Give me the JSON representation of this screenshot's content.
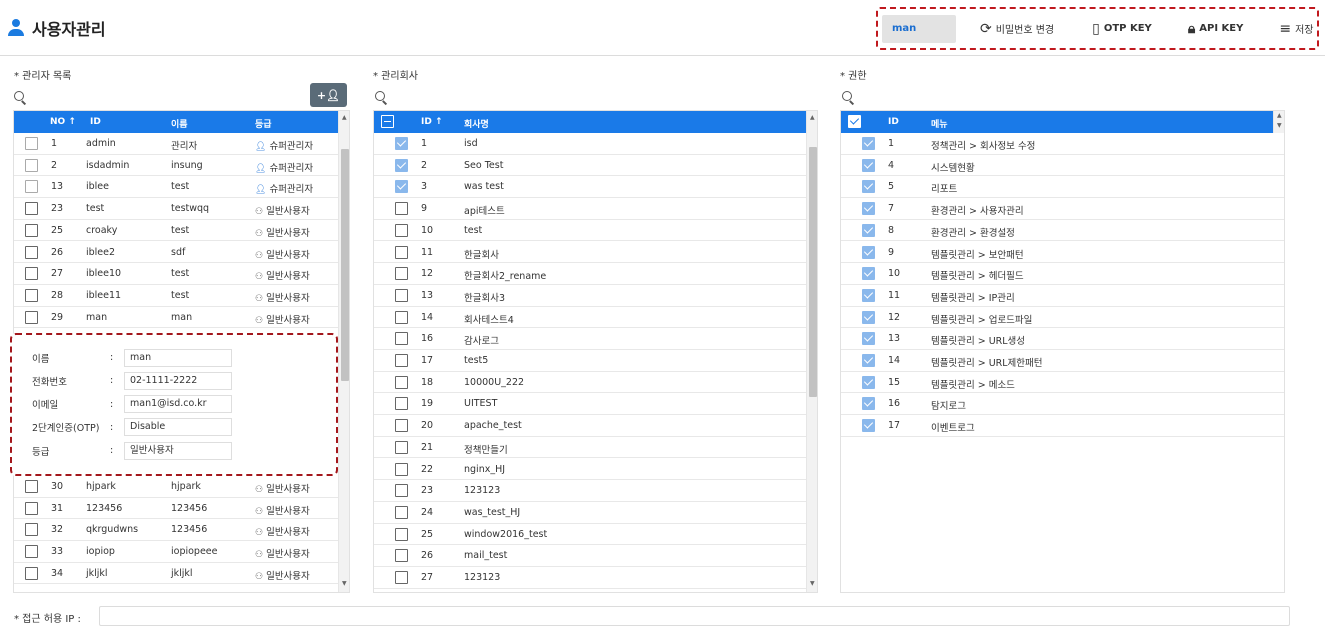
{
  "header": {
    "title": "사용자관리",
    "current_user": "man",
    "buttons": {
      "change_password": "비밀번호 변경",
      "otp_key": "OTP KEY",
      "api_key": "API KEY",
      "save": "저장"
    }
  },
  "admin_list": {
    "title": "* 관리자 목록",
    "columns": {
      "no": "NO",
      "id": "ID",
      "name": "이름",
      "grade": "등급"
    },
    "rows_top": [
      {
        "no": "1",
        "id": "admin",
        "name": "관리자",
        "grade": "슈퍼관리자",
        "type": "super",
        "dim": true
      },
      {
        "no": "2",
        "id": "isdadmin",
        "name": "insung",
        "grade": "슈퍼관리자",
        "type": "super",
        "dim": true
      },
      {
        "no": "13",
        "id": "iblee",
        "name": "test",
        "grade": "슈퍼관리자",
        "type": "super",
        "dim": true
      },
      {
        "no": "23",
        "id": "test",
        "name": "testwqq",
        "grade": "일반사용자",
        "type": "normal"
      },
      {
        "no": "25",
        "id": "croaky",
        "name": "test",
        "grade": "일반사용자",
        "type": "normal"
      },
      {
        "no": "26",
        "id": "iblee2",
        "name": "sdf",
        "grade": "일반사용자",
        "type": "normal"
      },
      {
        "no": "27",
        "id": "iblee10",
        "name": "test",
        "grade": "일반사용자",
        "type": "normal"
      },
      {
        "no": "28",
        "id": "iblee11",
        "name": "test",
        "grade": "일반사용자",
        "type": "normal"
      },
      {
        "no": "29",
        "id": "man",
        "name": "man",
        "grade": "일반사용자",
        "type": "normal"
      }
    ],
    "rows_bottom": [
      {
        "no": "30",
        "id": "hjpark",
        "name": "hjpark",
        "grade": "일반사용자",
        "type": "normal"
      },
      {
        "no": "31",
        "id": "123456",
        "name": "123456",
        "grade": "일반사용자",
        "type": "normal"
      },
      {
        "no": "32",
        "id": "qkrgudwns",
        "name": "123456",
        "grade": "일반사용자",
        "type": "normal"
      },
      {
        "no": "33",
        "id": "iopiop",
        "name": "iopiopeee",
        "grade": "일반사용자",
        "type": "normal"
      },
      {
        "no": "34",
        "id": "jkljkl",
        "name": "jkljkl",
        "grade": "일반사용자",
        "type": "normal"
      }
    ],
    "detail": {
      "fields": [
        {
          "label": "이름",
          "value": "man"
        },
        {
          "label": "전화번호",
          "value": "02-1111-2222"
        },
        {
          "label": "이메일",
          "value": "man1@isd.co.kr"
        },
        {
          "label": "2단계인증(OTP)",
          "value": "Disable"
        },
        {
          "label": "등급",
          "value": "일반사용자"
        }
      ]
    }
  },
  "company_list": {
    "title": "* 관리회사",
    "columns": {
      "id": "ID",
      "name": "회사명"
    },
    "rows": [
      {
        "id": "1",
        "name": "isd",
        "checked": true
      },
      {
        "id": "2",
        "name": "Seo Test",
        "checked": true
      },
      {
        "id": "3",
        "name": "was test",
        "checked": true
      },
      {
        "id": "9",
        "name": "api테스트",
        "checked": false
      },
      {
        "id": "10",
        "name": "test",
        "checked": false
      },
      {
        "id": "11",
        "name": "한글회사",
        "checked": false
      },
      {
        "id": "12",
        "name": "한글회사2_rename",
        "checked": false
      },
      {
        "id": "13",
        "name": "한글회사3",
        "checked": false
      },
      {
        "id": "14",
        "name": "회사테스트4",
        "checked": false
      },
      {
        "id": "16",
        "name": "감사로그",
        "checked": false
      },
      {
        "id": "17",
        "name": "test5",
        "checked": false
      },
      {
        "id": "18",
        "name": "10000U_222",
        "checked": false
      },
      {
        "id": "19",
        "name": "UITEST",
        "checked": false
      },
      {
        "id": "20",
        "name": "apache_test",
        "checked": false
      },
      {
        "id": "21",
        "name": "정책만들기",
        "checked": false
      },
      {
        "id": "22",
        "name": "nginx_HJ",
        "checked": false
      },
      {
        "id": "23",
        "name": "123123",
        "checked": false
      },
      {
        "id": "24",
        "name": "was_test_HJ",
        "checked": false
      },
      {
        "id": "25",
        "name": "window2016_test",
        "checked": false
      },
      {
        "id": "26",
        "name": "mail_test",
        "checked": false
      },
      {
        "id": "27",
        "name": "123123",
        "checked": false
      }
    ]
  },
  "permission_list": {
    "title": "* 권한",
    "columns": {
      "id": "ID",
      "menu": "메뉴"
    },
    "rows": [
      {
        "id": "1",
        "menu": "정책관리 > 회사정보 수정"
      },
      {
        "id": "4",
        "menu": "시스템현황"
      },
      {
        "id": "5",
        "menu": "리포트"
      },
      {
        "id": "7",
        "menu": "환경관리 > 사용자관리"
      },
      {
        "id": "8",
        "menu": "환경관리 > 환경설정"
      },
      {
        "id": "9",
        "menu": "템플릿관리 > 보안패턴"
      },
      {
        "id": "10",
        "menu": "템플릿관리 > 헤더필드"
      },
      {
        "id": "11",
        "menu": "템플릿관리 > IP관리"
      },
      {
        "id": "12",
        "menu": "템플릿관리 > 업로드파일"
      },
      {
        "id": "13",
        "menu": "템플릿관리 > URL생성"
      },
      {
        "id": "14",
        "menu": "템플릿관리 > URL제한패턴"
      },
      {
        "id": "15",
        "menu": "템플릿관리 > 메소드"
      },
      {
        "id": "16",
        "menu": "탐지로그"
      },
      {
        "id": "17",
        "menu": "이벤트로그"
      }
    ]
  },
  "access_ip": {
    "label": "* 접근 허용 IP :",
    "value": ""
  }
}
